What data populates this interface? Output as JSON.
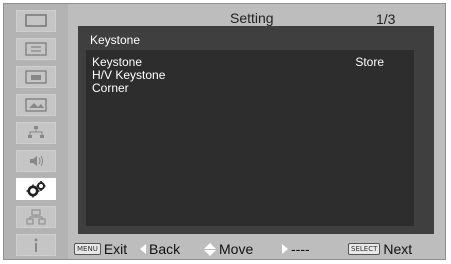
{
  "header": {
    "title": "Setting",
    "page": "1/3"
  },
  "sidebar": {
    "icons": [
      {
        "name": "screen-icon"
      },
      {
        "name": "image-adjust-icon"
      },
      {
        "name": "display-icon"
      },
      {
        "name": "image-select-icon"
      },
      {
        "name": "network-sub-icon"
      },
      {
        "name": "sound-icon"
      },
      {
        "name": "setting-gears-icon",
        "active": true
      },
      {
        "name": "network-icon"
      },
      {
        "name": "info-icon"
      }
    ]
  },
  "panel": {
    "title": "Keystone",
    "items": [
      "Keystone",
      "H/V Keystone",
      "Corner"
    ],
    "store_label": "Store"
  },
  "footer": {
    "menu_key": "MENU",
    "exit": "Exit",
    "back": "Back",
    "move": "Move",
    "next_arrow": "----",
    "select_key": "SELECT",
    "next": "Next"
  },
  "colors": {
    "panel": "#3f3f3f",
    "panel_inner": "#2d2d2d",
    "frame": "#bdbdbd",
    "text": "#ffffff"
  }
}
